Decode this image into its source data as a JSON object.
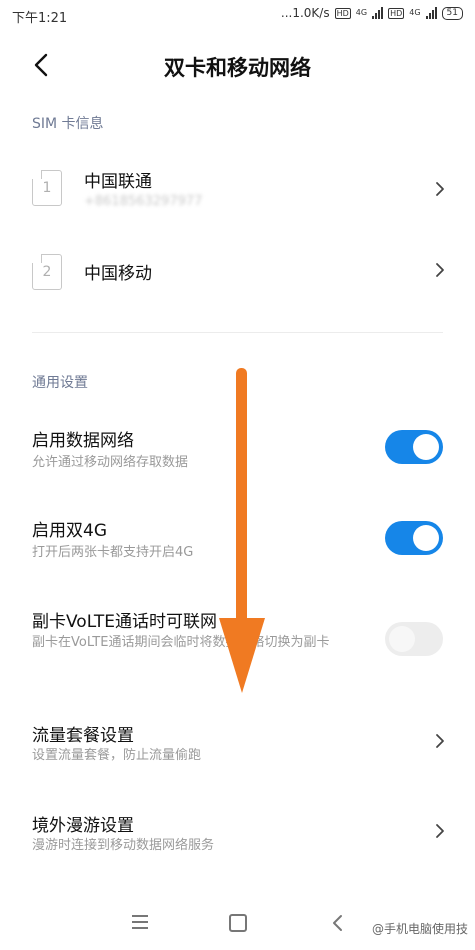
{
  "status_bar": {
    "time": "下午1:21",
    "net_speed": "...1.0K/s",
    "sim1_network": "4G",
    "sim2_network": "4G",
    "battery": "51"
  },
  "header": {
    "title": "双卡和移动网络",
    "back_icon": "chevron-left-icon"
  },
  "sim_section": {
    "label": "SIM 卡信息",
    "cards": [
      {
        "slot": "1",
        "carrier": "中国联通",
        "number": "+8618563297977"
      },
      {
        "slot": "2",
        "carrier": "中国移动",
        "number": ""
      }
    ]
  },
  "general_section": {
    "label": "通用设置",
    "items": [
      {
        "title": "启用数据网络",
        "subtitle": "允许通过移动网络存取数据",
        "control": "toggle",
        "state": true
      },
      {
        "title": "启用双4G",
        "subtitle": "打开后两张卡都支持开启4G",
        "control": "toggle",
        "state": true
      },
      {
        "title": "副卡VoLTE通话时可联网",
        "subtitle": "副卡在VoLTE通话期间会临时将数据网络切换为副卡",
        "control": "toggle",
        "state": false
      },
      {
        "title": "流量套餐设置",
        "subtitle": "设置流量套餐，防止流量偷跑",
        "control": "chevron"
      },
      {
        "title": "境外漫游设置",
        "subtitle": "漫游时连接到移动数据网络服务",
        "control": "chevron"
      }
    ]
  },
  "colors": {
    "toggle_on": "#1686e8",
    "toggle_off": "#ededed",
    "arrow": "#f07a22",
    "section_label": "#6f7a94"
  },
  "nav_bar": {
    "icons": [
      "menu-icon",
      "home-icon",
      "back-icon"
    ]
  },
  "watermark": "@手机电脑使用技"
}
